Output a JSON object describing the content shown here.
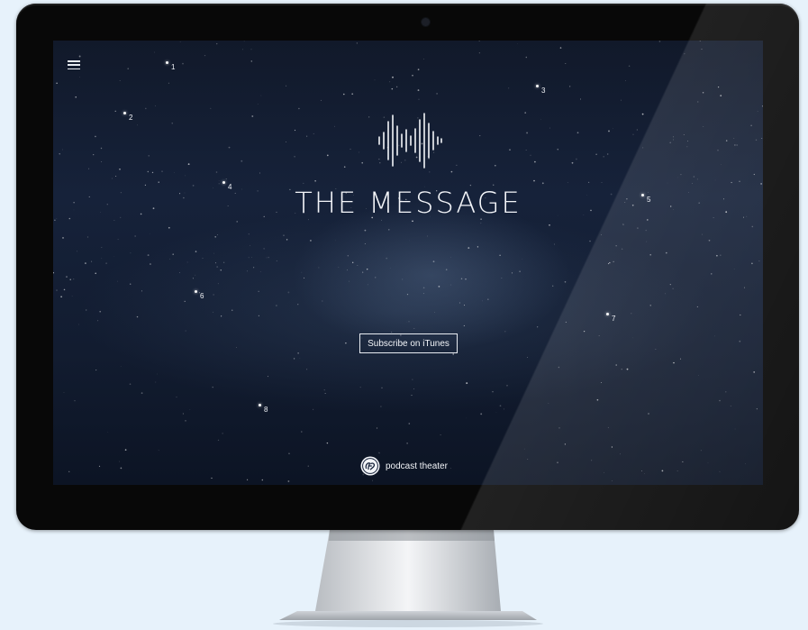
{
  "app": {
    "title": "THE MESSAGE"
  },
  "nav": {
    "menu_icon": "hamburger-menu-icon"
  },
  "markers": [
    {
      "label": "1"
    },
    {
      "label": "2"
    },
    {
      "label": "3"
    },
    {
      "label": "4"
    },
    {
      "label": "5"
    },
    {
      "label": "6"
    },
    {
      "label": "7"
    },
    {
      "label": "8"
    }
  ],
  "hero": {
    "logo_icon": "sound-waveform-icon",
    "title": "THE MESSAGE",
    "subscribe_label": "Subscribe on iTunes"
  },
  "footer": {
    "brand_icon": "ge-logo-icon",
    "brand_text": "podcast theater"
  },
  "colors": {
    "background": "#e7f2fb",
    "bezel": "#080808",
    "screen_dark": "#11192a",
    "foreground": "#f3f5f9"
  }
}
